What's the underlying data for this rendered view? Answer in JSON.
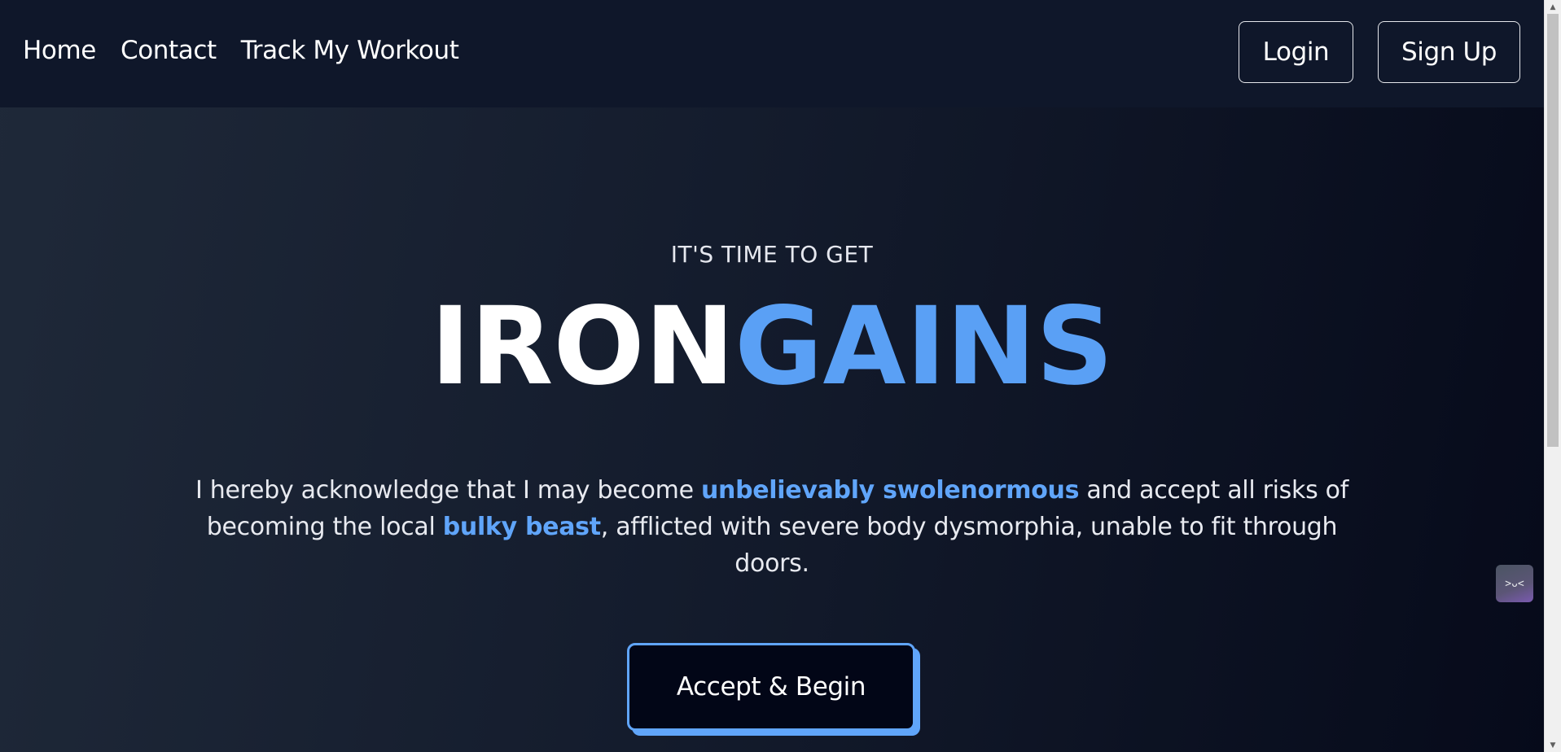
{
  "nav": {
    "links": [
      "Home",
      "Contact",
      "Track My Workout"
    ],
    "login_label": "Login",
    "signup_label": "Sign Up"
  },
  "hero": {
    "kicker": "IT'S TIME TO GET",
    "brand_part1": "IRON",
    "brand_part2": "GAINS",
    "disclaimer": {
      "part1": "I hereby acknowledge that I may become ",
      "highlight1": "unbelievably swolenormous",
      "part2": " and accept all risks of becoming the local ",
      "highlight2": "bulky beast",
      "part3": ", afflicted with severe body dysmorphia, unable to fit through doors."
    },
    "cta_label": "Accept & Begin"
  },
  "widget": {
    "glyph": ">ᴗ<",
    "icon": "assistant-face-icon"
  },
  "colors": {
    "accent": "#60a5fa",
    "brand_blue": "#5aa0f5",
    "nav_bg": "#0f172a",
    "cta_bg": "#020617"
  }
}
